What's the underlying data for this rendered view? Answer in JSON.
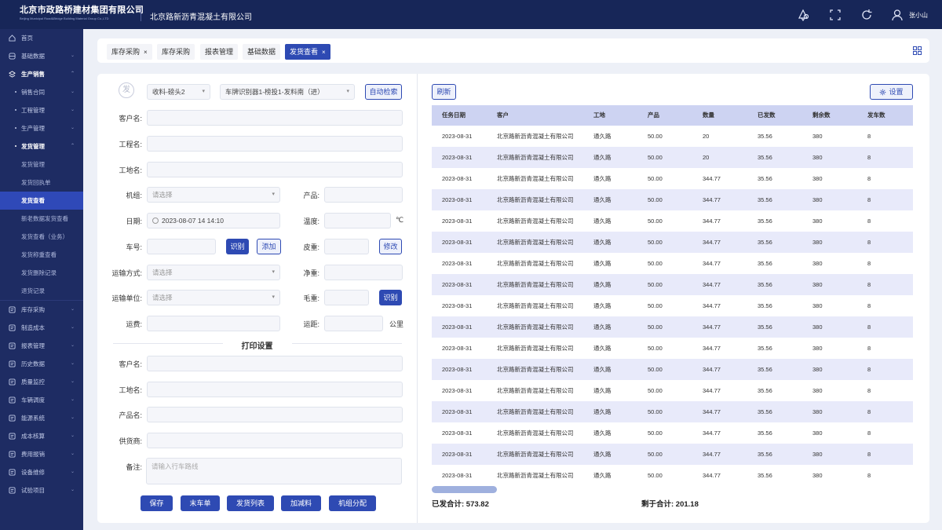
{
  "header": {
    "company_cn": "北京市政路桥建材集团有限公司",
    "company_en": "Beijing Municipal Road&Bridge Building Material Group Co.,LTD",
    "sub_company": "北京路新沥青混凝土有限公司",
    "user_name": "张小山",
    "icons": [
      "notification-icon",
      "fullscreen-icon",
      "refresh-icon",
      "user-icon"
    ]
  },
  "sidebar": {
    "top": [
      {
        "label": "首页",
        "icon": "home-icon"
      },
      {
        "label": "基础数据",
        "icon": "database-icon"
      }
    ],
    "section": {
      "label": "生产销售",
      "icon": "layers-icon"
    },
    "subs": [
      {
        "label": "销售合同"
      },
      {
        "label": "工程管理"
      },
      {
        "label": "生产管理"
      },
      {
        "label": "发货管理"
      }
    ],
    "leaves": [
      "发货管理",
      "发货回执单",
      "发货查看",
      "新老数据发货查看",
      "发货查看（业务）",
      "发货称重查看",
      "发货删除记录",
      "退货记录"
    ],
    "active_leaf": "发货查看",
    "bottom": [
      {
        "label": "库存采购",
        "icon": "inventory-icon"
      },
      {
        "label": "制造成本",
        "icon": "cost-icon"
      },
      {
        "label": "报表管理",
        "icon": "report-icon"
      },
      {
        "label": "历史数据",
        "icon": "history-icon"
      },
      {
        "label": "质量监控",
        "icon": "quality-icon"
      },
      {
        "label": "车辆调度",
        "icon": "truck-icon"
      },
      {
        "label": "能源系统",
        "icon": "energy-icon"
      },
      {
        "label": "成本核算",
        "icon": "calculator-icon"
      },
      {
        "label": "费用报销",
        "icon": "expense-icon"
      },
      {
        "label": "设备维修",
        "icon": "settings-icon"
      },
      {
        "label": "试验项目",
        "icon": "flask-icon"
      }
    ]
  },
  "tabs": [
    {
      "label": "库存采购",
      "closable": true,
      "active": false
    },
    {
      "label": "库存采购",
      "closable": false,
      "active": false
    },
    {
      "label": "报表管理",
      "closable": false,
      "active": false
    },
    {
      "label": "基础数据",
      "closable": false,
      "active": false
    },
    {
      "label": "发货查看",
      "closable": true,
      "active": true
    }
  ],
  "form": {
    "fa_char": "发",
    "scale_select": "收料-磅头2",
    "camera_select": "车牌识别器1-榜投1-发料南（进）",
    "auto_search": "自动检索",
    "customer": "客户名:",
    "project": "工程名:",
    "site": "工地名:",
    "unit_label": "机组:",
    "unit_placeholder": "请选择",
    "product": "产品:",
    "date": "日期:",
    "date_value": "2023-08-07 14 14:10",
    "temperature": "温度:",
    "temp_unit": "℃",
    "plate": "车号:",
    "recognize": "识别",
    "add": "添加",
    "tare": "皮重:",
    "modify": "修改",
    "transport_mode": "运输方式:",
    "transport_placeholder": "请选择",
    "net": "净重:",
    "carrier": "运输单位:",
    "carrier_placeholder": "请选择",
    "gross": "毛重:",
    "recognize2": "识别",
    "freight": "运费:",
    "distance": "运距:",
    "distance_unit": "公里",
    "print_title": "打印设置",
    "p_customer": "客户名:",
    "p_site": "工地名:",
    "p_product": "产品名:",
    "p_supplier": "供货商:",
    "p_remark": "备注:",
    "remark_placeholder": "请输入行车路线",
    "buttons": [
      "保存",
      "末车单",
      "发货列表",
      "加减料",
      "机组分配"
    ]
  },
  "table": {
    "refresh": "刷新",
    "settings": "设置",
    "columns": [
      "任务日期",
      "客户",
      "工地",
      "产品",
      "数量",
      "已发数",
      "剩余数",
      "发车数"
    ],
    "rows": [
      [
        "2023-08-31",
        "北京路新沥青混凝土有限公司",
        "通久路",
        "50.00",
        "20",
        "35.56",
        "380",
        "8"
      ],
      [
        "2023-08-31",
        "北京路新沥青混凝土有限公司",
        "通久路",
        "50.00",
        "20",
        "35.56",
        "380",
        "8"
      ],
      [
        "2023-08-31",
        "北京路新沥青混凝土有限公司",
        "通久路",
        "50.00",
        "344.77",
        "35.56",
        "380",
        "8"
      ],
      [
        "2023-08-31",
        "北京路新沥青混凝土有限公司",
        "通久路",
        "50.00",
        "344.77",
        "35.56",
        "380",
        "8"
      ],
      [
        "2023-08-31",
        "北京路新沥青混凝土有限公司",
        "通久路",
        "50.00",
        "344.77",
        "35.56",
        "380",
        "8"
      ],
      [
        "2023-08-31",
        "北京路新沥青混凝土有限公司",
        "通久路",
        "50.00",
        "344.77",
        "35.56",
        "380",
        "8"
      ],
      [
        "2023-08-31",
        "北京路新沥青混凝土有限公司",
        "通久路",
        "50.00",
        "344.77",
        "35.56",
        "380",
        "8"
      ],
      [
        "2023-08-31",
        "北京路新沥青混凝土有限公司",
        "通久路",
        "50.00",
        "344.77",
        "35.56",
        "380",
        "8"
      ],
      [
        "2023-08-31",
        "北京路新沥青混凝土有限公司",
        "通久路",
        "50.00",
        "344.77",
        "35.56",
        "380",
        "8"
      ],
      [
        "2023-08-31",
        "北京路新沥青混凝土有限公司",
        "通久路",
        "50.00",
        "344.77",
        "35.56",
        "380",
        "8"
      ],
      [
        "2023-08-31",
        "北京路新沥青混凝土有限公司",
        "通久路",
        "50.00",
        "344.77",
        "35.56",
        "380",
        "8"
      ],
      [
        "2023-08-31",
        "北京路新沥青混凝土有限公司",
        "通久路",
        "50.00",
        "344.77",
        "35.56",
        "380",
        "8"
      ],
      [
        "2023-08-31",
        "北京路新沥青混凝土有限公司",
        "通久路",
        "50.00",
        "344.77",
        "35.56",
        "380",
        "8"
      ],
      [
        "2023-08-31",
        "北京路新沥青混凝土有限公司",
        "通久路",
        "50.00",
        "344.77",
        "35.56",
        "380",
        "8"
      ],
      [
        "2023-08-31",
        "北京路新沥青混凝土有限公司",
        "通久路",
        "50.00",
        "344.77",
        "35.56",
        "380",
        "8"
      ],
      [
        "2023-08-31",
        "北京路新沥青混凝土有限公司",
        "通久路",
        "50.00",
        "344.77",
        "35.56",
        "380",
        "8"
      ],
      [
        "2023-08-31",
        "北京路新沥青混凝土有限公司",
        "通久路",
        "50.00",
        "344.77",
        "35.56",
        "380",
        "8"
      ]
    ],
    "sent_total_label": "已发合计: 573.82",
    "remain_total_label": "剩于合计: 201.18"
  },
  "colors": {
    "primary": "#2e4ab3",
    "header_bg": "#172658",
    "sidebar_bg": "#1e2c63",
    "table_header": "#cdd3f2",
    "row_stripe": "#e8eafa"
  }
}
